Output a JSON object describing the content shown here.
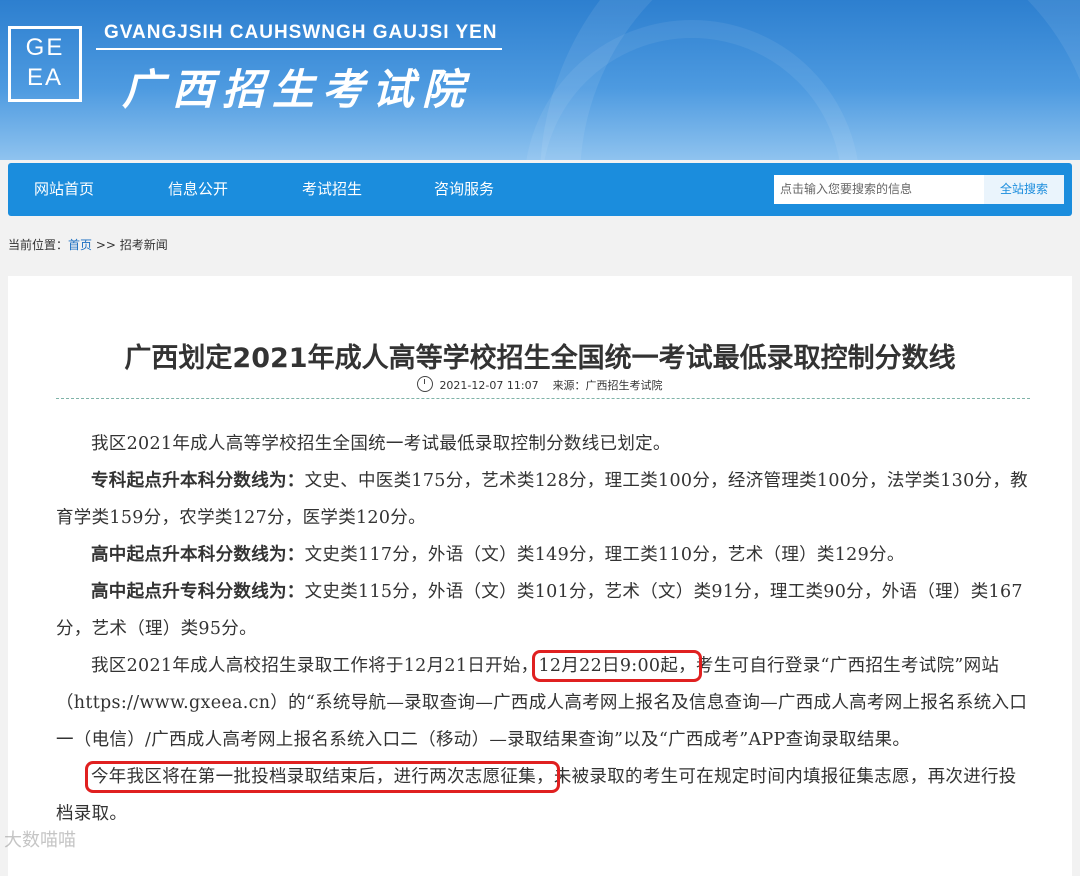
{
  "header": {
    "logo_text": "GE\nEA",
    "site_name_en": "GVANGJSIH CAUHSWNGH GAUJSI YEN",
    "site_name_cn": "广西招生考试院"
  },
  "nav": {
    "items": [
      "网站首页",
      "信息公开",
      "考试招生",
      "咨询服务"
    ],
    "search_placeholder": "点击输入您要搜索的信息",
    "search_button": "全站搜索"
  },
  "breadcrumb": {
    "prefix": "当前位置：",
    "home": "首页",
    "sep": " >> ",
    "current": "招考新闻"
  },
  "article": {
    "title": "广西划定2021年成人高等学校招生全国统一考试最低录取控制分数线",
    "date": "2021-12-07 11:07",
    "source": "来源：广西招生考试院",
    "p1": "我区2021年成人高等学校招生全国统一考试最低录取控制分数线已划定。",
    "p2_label": "专科起点升本科分数线为：",
    "p2_text": "文史、中医类175分，艺术类128分，理工类100分，经济管理类100分，法学类130分，教育学类159分，农学类127分，医学类120分。",
    "p3_label": "高中起点升本科分数线为：",
    "p3_text": "文史类117分，外语（文）类149分，理工类110分，艺术（理）类129分。",
    "p4_label": "高中起点升专科分数线为：",
    "p4_text": "文史类115分，外语（文）类101分，艺术（文）类91分，理工类90分，外语（理）类167分，艺术（理）类95分。",
    "p5_a": "我区2021年成人高校招生录取工作将于12月21日开始，",
    "p5_hl": "12月22日9:00起，",
    "p5_b": "考生可自行登录“广西招生考试院”网站（https://www.gxeea.cn）的“系统导航—录取查询—广西成人高考网上报名及信息查询—广西成人高考网上报名系统入口一（电信）/广西成人高考网上报名系统入口二（移动）—录取结果查询”以及“广西成考”APP查询录取结果。",
    "p6_hl": "今年我区将在第一批投档录取结束后，进行两次志愿征集，",
    "p6_b": "未被录取的考生可在规定时间内填报征集志愿，再次进行投档录取。"
  },
  "watermark": "大数喵喵",
  "colors": {
    "nav": "#1b8ddd",
    "highlight": "#e02020",
    "header": "#2d7fcf"
  }
}
